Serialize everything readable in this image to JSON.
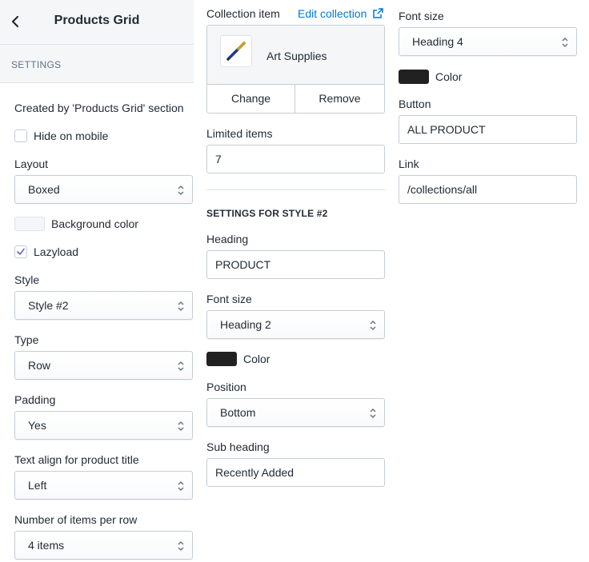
{
  "header": {
    "title": "Products Grid",
    "back_icon": "chevron-left-icon"
  },
  "settings_label": "SETTINGS",
  "section_note": "Created by 'Products Grid' section",
  "hide_on_mobile": {
    "label": "Hide on mobile",
    "checked": false
  },
  "layout": {
    "label": "Layout",
    "value": "Boxed"
  },
  "background_color": {
    "label": "Background color",
    "color": "#f4f6f8"
  },
  "lazyload": {
    "label": "Lazyload",
    "checked": true
  },
  "style": {
    "label": "Style",
    "value": "Style #2"
  },
  "type": {
    "label": "Type",
    "value": "Row"
  },
  "padding": {
    "label": "Padding",
    "value": "Yes"
  },
  "text_align": {
    "label": "Text align for product title",
    "value": "Left"
  },
  "items_per_row": {
    "label": "Number of items per row",
    "value": "4 items"
  },
  "collection": {
    "label": "Collection item",
    "edit_link": "Edit collection",
    "name": "Art Supplies",
    "change_label": "Change",
    "remove_label": "Remove"
  },
  "limited_items": {
    "label": "Limited items",
    "value": "7"
  },
  "style2": {
    "section_title": "SETTINGS FOR STYLE #2",
    "heading": {
      "label": "Heading",
      "value": "PRODUCT"
    },
    "font_size": {
      "label": "Font size",
      "value": "Heading 2"
    },
    "color": {
      "label": "Color",
      "color": "#212121"
    },
    "position": {
      "label": "Position",
      "value": "Bottom"
    },
    "sub_heading": {
      "label": "Sub heading",
      "value": "Recently Added"
    }
  },
  "right": {
    "font_size": {
      "label": "Font size",
      "value": "Heading 4"
    },
    "color": {
      "label": "Color",
      "color": "#212121"
    },
    "button": {
      "label": "Button",
      "value": "ALL PRODUCT"
    },
    "link": {
      "label": "Link",
      "value": "/collections/all"
    }
  },
  "colors": {
    "accent": "#007ace",
    "text": "#212b36",
    "border": "#c4cdd5",
    "panel": "#f4f6f8"
  }
}
